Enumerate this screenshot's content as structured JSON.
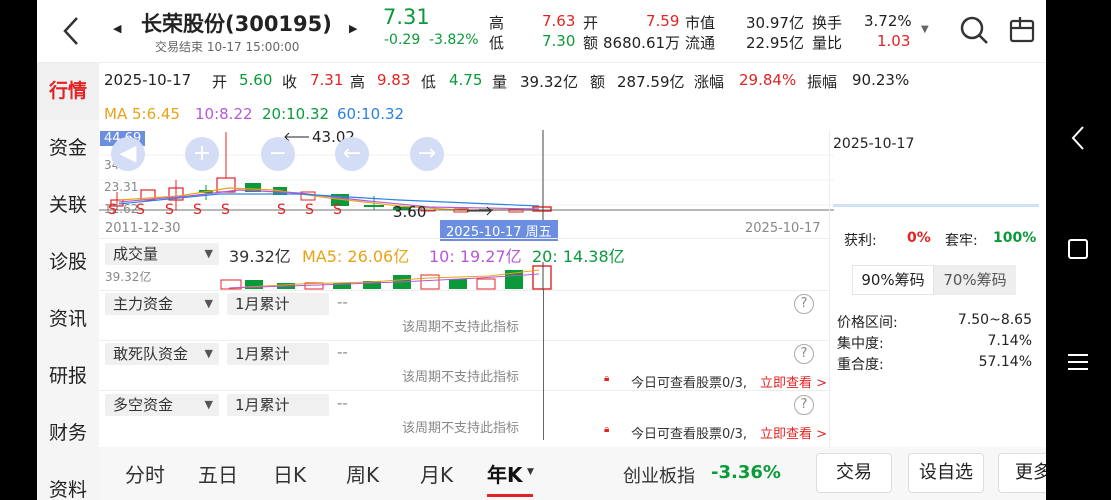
{
  "header": {
    "back_icon": "chevron-left-icon",
    "stock_name": "长荣股份(300195)",
    "status": "交易结束 10-17 15:00:00",
    "price": "7.31",
    "change": "-0.29",
    "change_pct": "-3.82%",
    "high_label": "高",
    "high_value": "7.63",
    "low_label": "低",
    "low_value": "7.30",
    "open_label": "开",
    "open_value": "7.59",
    "amount_label": "额",
    "amount_value": "8680.61万",
    "mktcap_label": "市值",
    "mktcap_value": "30.97亿",
    "float_label": "流通",
    "float_value": "22.95亿",
    "turnover_label": "换手",
    "turnover_value": "3.72%",
    "volratio_label": "量比",
    "volratio_value": "1.03"
  },
  "sidenav": [
    "行情",
    "资金",
    "关联",
    "诊股",
    "资讯",
    "研报",
    "财务",
    "资料"
  ],
  "summary": {
    "date": "2025-10-17",
    "open_label": "开",
    "open": "5.60",
    "close_label": "收",
    "close": "7.31",
    "high_label": "高",
    "high": "9.83",
    "low_label": "低",
    "low": "4.75",
    "vol_label": "量",
    "vol": "39.32亿",
    "amt_label": "额",
    "amt": "287.59亿",
    "chg_label": "涨幅",
    "chg": "29.84%",
    "amp_label": "振幅",
    "amp": "90.23%"
  },
  "ma": {
    "ma5": "MA 5:6.45",
    "ma10": "10:8.22",
    "ma20": "20:10.32",
    "ma60": "60:10.32"
  },
  "chart": {
    "y_top": "44.69",
    "y_mid1": "34.00",
    "y_mid2": "23.31",
    "y_bottom": "12.62",
    "max_annot": "43.02",
    "min_annot": "3.60",
    "date_start": "2011-12-30",
    "date_end": "2025-10-17",
    "crosshair_date": "2025-10-17 周五",
    "s_marks": [
      "S",
      "S",
      "S",
      "S",
      "S",
      "S",
      "S",
      "S"
    ]
  },
  "volume": {
    "selector": "成交量",
    "value": "39.32亿",
    "ma5": "MA5: 26.06亿",
    "ma10": "10: 19.27亿",
    "ma20": "20: 14.38亿",
    "axis_label": "39.32亿"
  },
  "indicators": [
    {
      "selector": "主力资金",
      "period": "1月累计",
      "value": "--",
      "note": "该周期不支持此指标",
      "promo": ""
    },
    {
      "selector": "敢死队资金",
      "period": "1月累计",
      "value": "--",
      "note": "该周期不支持此指标",
      "promo": "今日可查看股票0/3,"
    },
    {
      "selector": "多空资金",
      "period": "1月累计",
      "value": "--",
      "note": "该周期不支持此指标",
      "promo": "今日可查看股票0/3,"
    }
  ],
  "promo_link": "立即查看 >",
  "right_panel": {
    "date": "2025-10-17",
    "profit_label": "获利:",
    "profit": "0%",
    "trapped_label": "套牢:",
    "trapped": "100%",
    "tab1": "90%筹码",
    "tab2": "70%筹码",
    "range_label": "价格区间:",
    "range": "7.50~8.65",
    "conc_label": "集中度:",
    "conc": "7.14%",
    "overlap_label": "重合度:",
    "overlap": "57.14%"
  },
  "bottom": {
    "tabs": [
      "分时",
      "五日",
      "日K",
      "周K",
      "月K",
      "年K"
    ],
    "index_name": "创业板指",
    "index_change": "-3.36%",
    "trade": "交易",
    "watchlist": "设自选",
    "more": "更多"
  },
  "colors": {
    "up": "#e32323",
    "down": "#0a9a3a",
    "accent": "#2a82e4"
  }
}
